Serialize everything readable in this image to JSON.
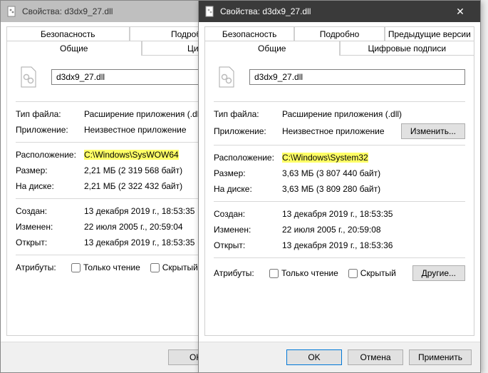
{
  "tabs": {
    "security": "Безопасность",
    "details": "Подробно",
    "previous": "Предыдущие версии",
    "previous_short": "Пре",
    "general": "Общие",
    "sigs": "Цифровые подписи",
    "sigs_short": "Цифровые"
  },
  "labels": {
    "filetype": "Тип файла:",
    "app": "Приложение:",
    "location": "Расположение:",
    "size": "Размер:",
    "ondisk": "На диске:",
    "created": "Создан:",
    "modified": "Изменен:",
    "accessed": "Открыт:",
    "attributes": "Атрибуты:",
    "readonly": "Только чтение",
    "hidden": "Скрытый"
  },
  "buttons": {
    "change": "Изменить...",
    "other": "Другие...",
    "ok": "OK",
    "cancel": "Отмена",
    "cancel_short": "Отмен",
    "apply": "Применить"
  },
  "left": {
    "title": "Свойства: d3dx9_27.dll",
    "filename": "d3dx9_27.dll",
    "filetype": "Расширение приложения (.dll)",
    "app": "Неизвестное приложение",
    "location": "C:\\Windows\\SysWOW64",
    "size": "2,21 МБ (2 319 568 байт)",
    "ondisk": "2,21 МБ (2 322 432 байт)",
    "created": "13 декабря 2019 г., 18:53:35",
    "modified": "22 июля 2005 г., 20:59:04",
    "accessed": "13 декабря 2019 г., 18:53:35"
  },
  "right": {
    "title": "Свойства: d3dx9_27.dll",
    "filename": "d3dx9_27.dll",
    "filetype": "Расширение приложения (.dll)",
    "app": "Неизвестное приложение",
    "location": "C:\\Windows\\System32",
    "size": "3,63 МБ (3 807 440 байт)",
    "ondisk": "3,63 МБ (3 809 280 байт)",
    "created": "13 декабря 2019 г., 18:53:35",
    "modified": "22 июля 2005 г., 20:59:08",
    "accessed": "13 декабря 2019 г., 18:53:36"
  }
}
